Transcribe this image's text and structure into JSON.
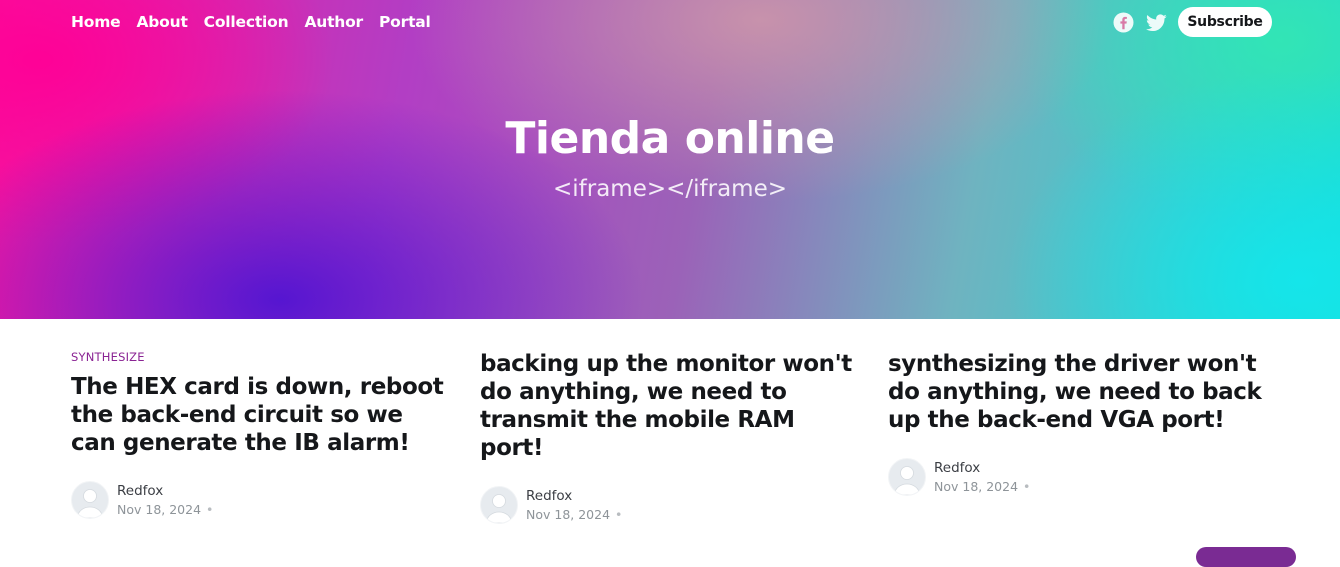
{
  "nav": {
    "items": [
      "Home",
      "About",
      "Collection",
      "Author",
      "Portal"
    ]
  },
  "social": {
    "icons": [
      "facebook-icon",
      "twitter-icon"
    ]
  },
  "subscribe_label": "Subscribe",
  "hero": {
    "title": "Tienda online",
    "description": "<iframe></iframe>"
  },
  "posts": [
    {
      "tag": "SYNTHESIZE",
      "title": "The HEX card is down, reboot the back-end circuit so we can generate the IB alarm!",
      "author": "Redfox",
      "date": "Nov 18, 2024"
    },
    {
      "tag": "",
      "title": "backing up the monitor won't do anything, we need to transmit the mobile RAM port!",
      "author": "Redfox",
      "date": "Nov 18, 2024"
    },
    {
      "tag": "",
      "title": "synthesizing the driver won't do anything, we need to back up the back-end VGA port!",
      "author": "Redfox",
      "date": "Nov 18, 2024"
    }
  ],
  "colors": {
    "accent": "#8a2393",
    "text": "#15171a",
    "muted": "#8e9499"
  }
}
